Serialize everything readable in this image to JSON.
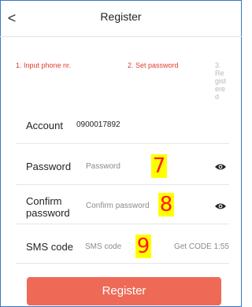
{
  "header": {
    "title": "Register",
    "back_glyph": "<"
  },
  "steps": [
    {
      "label": "1. Input phone nr."
    },
    {
      "label": "2. Set password"
    },
    {
      "label": "3. Registered"
    }
  ],
  "form": {
    "account": {
      "label": "Account",
      "value": "0900017892"
    },
    "password": {
      "label": "Password",
      "placeholder": "Password",
      "marker": "7"
    },
    "confirm": {
      "label": "Confirm password",
      "placeholder": "Confirm password",
      "marker": "8"
    },
    "sms": {
      "label": "SMS code",
      "placeholder": "SMS code",
      "marker": "9",
      "get_code": "Get CODE 1:55"
    }
  },
  "register_button": "Register",
  "colors": {
    "accent": "#ee6a57",
    "step_active": "#e23b2f",
    "marker_bg": "#ffff00",
    "marker_fg": "#ff1a1a",
    "frame": "#3a78c2"
  }
}
